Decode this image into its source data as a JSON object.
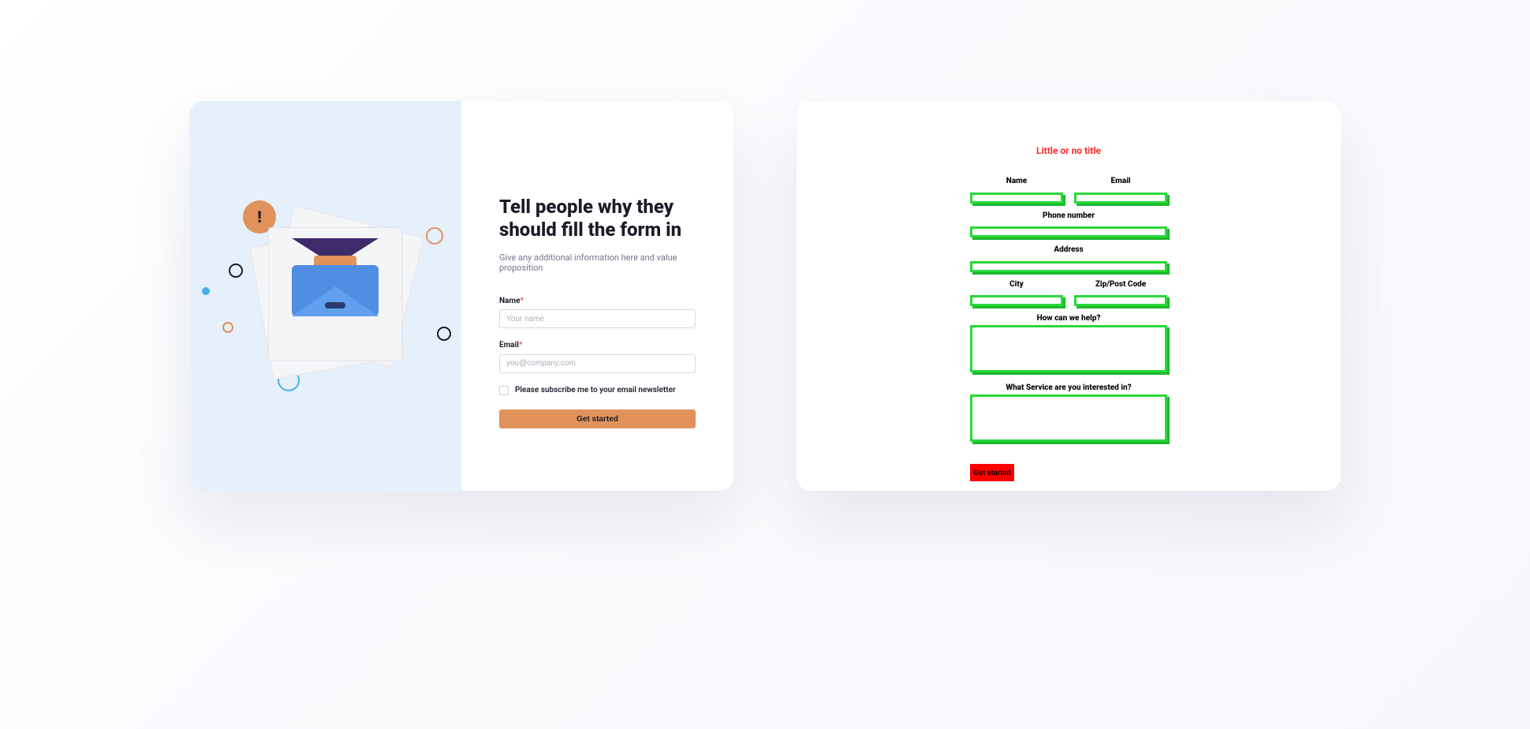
{
  "good": {
    "heading": "Tell people why they should fill the form in",
    "subheading": "Give any additional information here and value proposition",
    "name_label": "Name",
    "name_placeholder": "Your name",
    "email_label": "Email",
    "email_placeholder": "you@company.com",
    "subscribe_label": "Please subscribe me to your email newsletter",
    "cta": "Get started",
    "required_marker": "*"
  },
  "bad": {
    "title": "Little or no title",
    "labels": {
      "name": "Name",
      "email": "Email",
      "phone": "Phone number",
      "address": "Address",
      "city": "City",
      "zip": "Zip/Post Code",
      "help": "How can we help?",
      "service": "What Service are you interested in?"
    },
    "cta": "Get started"
  },
  "colors": {
    "accent_orange": "#e0925a",
    "accent_red": "#ff0000",
    "accent_green": "#29d93a",
    "illus_bg": "#e6f0fb"
  }
}
